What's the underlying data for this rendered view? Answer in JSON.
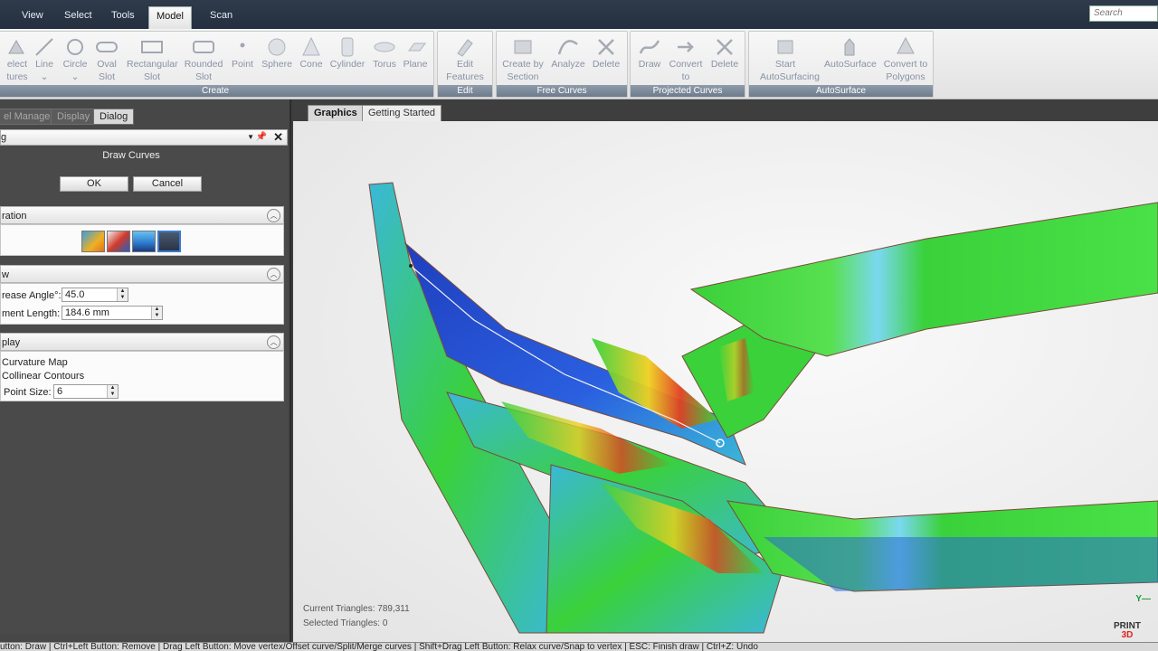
{
  "menu": {
    "tabs": [
      "View",
      "Select",
      "Tools",
      "Model",
      "Scan"
    ],
    "active": "Model",
    "search_placeholder": "Search"
  },
  "ribbon": {
    "create": {
      "label": "Create",
      "items": [
        {
          "line1": "elect",
          "line2": "tures"
        },
        {
          "line1": "Line",
          "line2": ""
        },
        {
          "line1": "Circle",
          "line2": ""
        },
        {
          "line1": "Oval",
          "line2": "Slot"
        },
        {
          "line1": "Rectangular",
          "line2": "Slot"
        },
        {
          "line1": "Rounded",
          "line2": "Slot"
        },
        {
          "line1": "Point",
          "line2": ""
        },
        {
          "line1": "Sphere",
          "line2": ""
        },
        {
          "line1": "Cone",
          "line2": ""
        },
        {
          "line1": "Cylinder",
          "line2": ""
        },
        {
          "line1": "Torus",
          "line2": ""
        },
        {
          "line1": "Plane",
          "line2": ""
        }
      ]
    },
    "edit": {
      "label": "Edit",
      "items": [
        {
          "line1": "Edit",
          "line2": "Features"
        }
      ]
    },
    "free_curves": {
      "label": "Free Curves",
      "items": [
        {
          "line1": "Create by",
          "line2": "Section"
        },
        {
          "line1": "Analyze",
          "line2": ""
        },
        {
          "line1": "Delete",
          "line2": ""
        }
      ]
    },
    "projected_curves": {
      "label": "Projected Curves",
      "items": [
        {
          "line1": "Draw",
          "line2": ""
        },
        {
          "line1": "Convert",
          "line2": "to"
        },
        {
          "line1": "Delete",
          "line2": ""
        }
      ]
    },
    "autosurface": {
      "label": "AutoSurface",
      "items": [
        {
          "line1": "Start",
          "line2": "AutoSurfacing"
        },
        {
          "line1": "AutoSurface",
          "line2": ""
        },
        {
          "line1": "Convert to",
          "line2": "Polygons"
        }
      ]
    }
  },
  "panel": {
    "tabs": [
      "el Manager",
      "Display",
      "Dialog"
    ],
    "active_tab": "Dialog",
    "dialog_header": "g",
    "dialog_title": "Draw Curves",
    "ok_label": "OK",
    "cancel_label": "Cancel",
    "sections": {
      "operation": {
        "title": "ration"
      },
      "view": {
        "title": "w",
        "crease_angle_label": "rease Angle°:",
        "crease_angle_value": "45.0",
        "segment_length_label": "ment Length:",
        "segment_length_value": "184.6 mm"
      },
      "display": {
        "title": "play",
        "curvature_map_label": "Curvature Map",
        "collinear_label": "Collinear Contours",
        "point_size_label": "Point Size:",
        "point_size_value": "6"
      }
    },
    "op_colors": [
      "#e0a020",
      "#d23a2a",
      "#2e7fd0",
      "#3a4a60"
    ]
  },
  "graphics": {
    "tabs": [
      "Graphics",
      "Getting Started"
    ],
    "active_tab": "Graphics",
    "current_triangles": "Current Triangles: 789,311",
    "selected_triangles": "Selected Triangles: 0",
    "logo_line1": "PRINT",
    "logo_line2": "3D",
    "axis_label": "Y"
  },
  "statusbar": {
    "text": "utton: Draw | Ctrl+Left Button: Remove | Drag Left Button: Move vertex/Offset curve/Split/Merge curves | Shift+Drag Left Button: Relax curve/Snap to vertex | ESC: Finish draw | Ctrl+Z: Undo"
  },
  "colors": {
    "accent_blue": "#1f3fbf",
    "heat_green": "#3ad13a",
    "heat_red": "#e04020",
    "heat_cyan": "#3ab8d8"
  }
}
